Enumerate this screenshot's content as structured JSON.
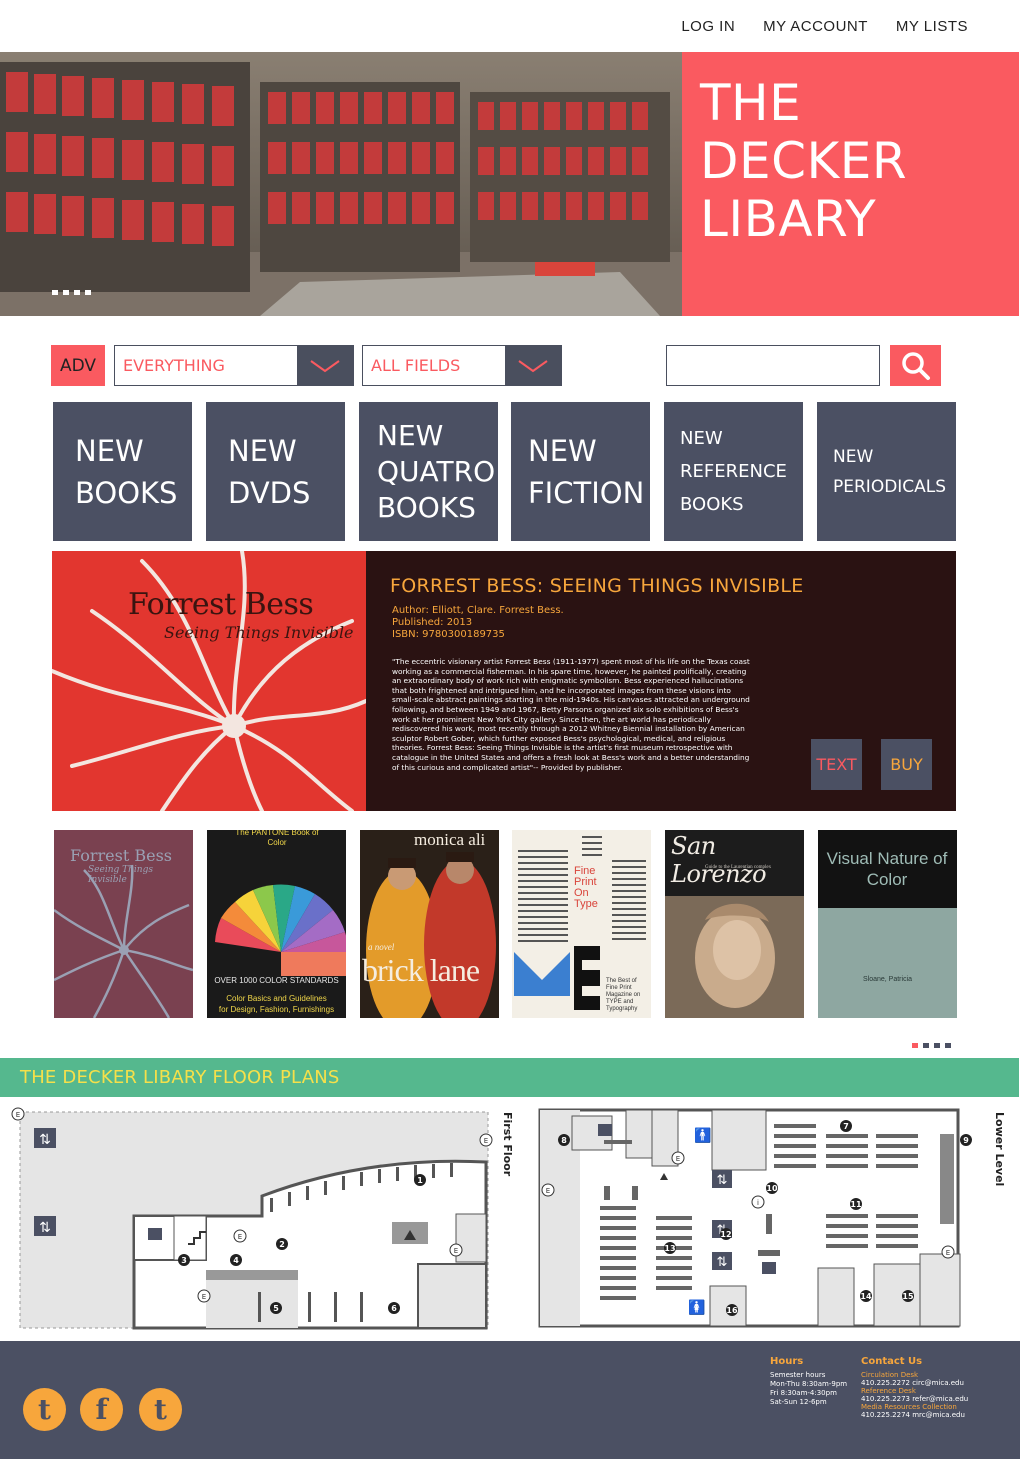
{
  "nav": {
    "login": "LOG IN",
    "account": "MY ACCOUNT",
    "lists": "MY LISTS"
  },
  "hero": {
    "title_lines": [
      "THE",
      "DECKER",
      "LIBARY"
    ],
    "slide_count": 4
  },
  "search": {
    "adv_label": "ADV",
    "scope_value": "EVERYTHING",
    "field_value": "ALL FIELDS",
    "query_placeholder": "",
    "icons": {
      "dropdown": "chevron-down-icon",
      "search": "search-icon"
    }
  },
  "tiles": [
    {
      "lines": [
        "NEW",
        "BOOKS"
      ]
    },
    {
      "lines": [
        "NEW",
        "DVDS"
      ]
    },
    {
      "lines": [
        "NEW",
        "QUATRO",
        "BOOKS"
      ]
    },
    {
      "lines": [
        "NEW",
        "FICTION"
      ]
    },
    {
      "lines": [
        "NEW",
        "REFERENCE",
        "BOOKS"
      ]
    },
    {
      "lines": [
        "NEW",
        "PERIODICALS"
      ]
    }
  ],
  "feature": {
    "cover_title": "Forrest Bess",
    "cover_subtitle": "Seeing Things Invisible",
    "title": "FORREST BESS: SEEING THINGS INVISIBLE",
    "author": "Author: Elliott, Clare. Forrest Bess.",
    "published": "Published: 2013",
    "isbn": "ISBN: 9780300189735",
    "description": "\"The eccentric visionary artist Forrest Bess (1911-1977) spent most of his life on the Texas coast working as a commercial fisherman. In his spare time, however, he painted prolifically, creating an extraordinary body of work rich with enigmatic symbolism. Bess experienced hallucinations that both frightened and intrigued him, and he incorporated images from these visions into small-scale abstract paintings starting in the mid-1940s. His canvases attracted an underground following, and between 1949 and 1967, Betty Parsons organized six solo exhibitions of Bess's work at her prominent New York City gallery. Since then, the art world has periodically rediscovered his work, most recently through a 2012 Whitney Biennial installation by American sculptor Robert Gober, which further exposed Bess's psychological, medical, and religious theories. Forrest Bess: Seeing Things Invisible is the artist's first museum retrospective with catalogue in the United States and offers a fresh look at Bess's work and a better understanding of this curious and complicated artist\"-- Provided by publisher.",
    "text_button": "TEXT",
    "buy_button": "BUY"
  },
  "covers": [
    {
      "title": "Forrest Bess",
      "subtitle": "Seeing Things Invisible"
    },
    {
      "title": "The PANTONE Book of Color",
      "line1": "OVER 1000 COLOR STANDARDS",
      "line2": "Color Basics and Guidelines",
      "line3": "for Design, Fashion, Furnishings"
    },
    {
      "author": "monica ali",
      "tag": "a novel",
      "title": "brick lane"
    },
    {
      "title": "Fine Print On Type",
      "subtitle": "The Best of Fine Print Magazine on TYPE and Typography"
    },
    {
      "title": "San Lorenzo",
      "subtitle": "Guide to the Laurentian complex"
    },
    {
      "title": "Visual Nature of Color",
      "author": "Sloane, Patricia"
    }
  ],
  "carousel": {
    "pages": 4,
    "active": 0
  },
  "floorplans": {
    "heading": "THE DECKER LIBARY FLOOR PLANS",
    "first_label": "First Floor",
    "lower_label": "Lower Level",
    "first_markers": [
      "1",
      "2",
      "3",
      "4",
      "5",
      "6"
    ],
    "lower_markers": [
      "7",
      "8",
      "9",
      "10",
      "11",
      "12",
      "13",
      "14",
      "15",
      "16"
    ],
    "entrance": "E",
    "info": "i"
  },
  "footer": {
    "social": [
      {
        "icon": "tumblr-icon",
        "glyph": "t"
      },
      {
        "icon": "facebook-icon",
        "glyph": "f"
      },
      {
        "icon": "twitter-icon",
        "glyph": "t"
      }
    ],
    "hours_heading": "Hours",
    "hours": [
      "Semester hours",
      "Mon-Thu 8:30am-9pm",
      "Fri 8:30am-4:30pm",
      "Sat-Sun 12-6pm"
    ],
    "contact_heading": "Contact Us",
    "contacts": [
      {
        "label": "Circulation Desk",
        "value": "410.225.2272 circ@mica.edu"
      },
      {
        "label": "Reference Desk",
        "value": "410.225.2273 refer@mica.edu"
      },
      {
        "label": "Media Resources Collection",
        "value": "410.225.2274 mrc@mica.edu"
      }
    ]
  },
  "colors": {
    "coral": "#fa5a60",
    "slate": "#4b5063",
    "orange": "#f7a63c",
    "green": "#55b88e",
    "yellow": "#f5e04a",
    "maroon": "#2a1212"
  }
}
